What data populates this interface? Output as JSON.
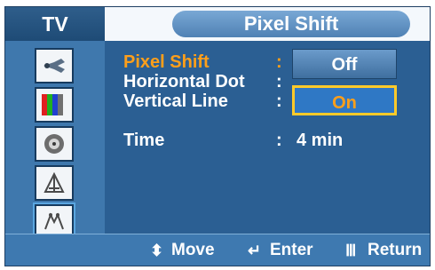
{
  "header": {
    "tv_tab": "TV",
    "title": "Pixel Shift"
  },
  "sidebar": {
    "items": [
      {
        "name": "input-icon",
        "active": false
      },
      {
        "name": "picture-icon",
        "active": false
      },
      {
        "name": "sound-icon",
        "active": false
      },
      {
        "name": "channel-icon",
        "active": false
      },
      {
        "name": "setup-icon",
        "active": true
      }
    ]
  },
  "menu": {
    "rows": [
      {
        "label": "Pixel Shift",
        "colon": ":",
        "value": "",
        "highlight": true
      },
      {
        "label": "Horizontal Dot",
        "colon": ":",
        "value": ""
      },
      {
        "label": "Vertical Line",
        "colon": ":",
        "value": ""
      },
      {
        "label": "Time",
        "colon": ":",
        "value": "4  min"
      }
    ]
  },
  "dropdown": {
    "options": [
      "Off",
      "On"
    ],
    "selected": "On"
  },
  "footer": {
    "move_icon": "updown-arrows-icon",
    "move_label": "Move",
    "enter_icon": "enter-icon",
    "enter_label": "Enter",
    "return_icon": "menu-bars-icon",
    "return_label": "Return"
  },
  "colors": {
    "panel_bg": "#2b5f93",
    "highlight_text": "#ff9f1a",
    "selected_border": "#ffca2a"
  }
}
